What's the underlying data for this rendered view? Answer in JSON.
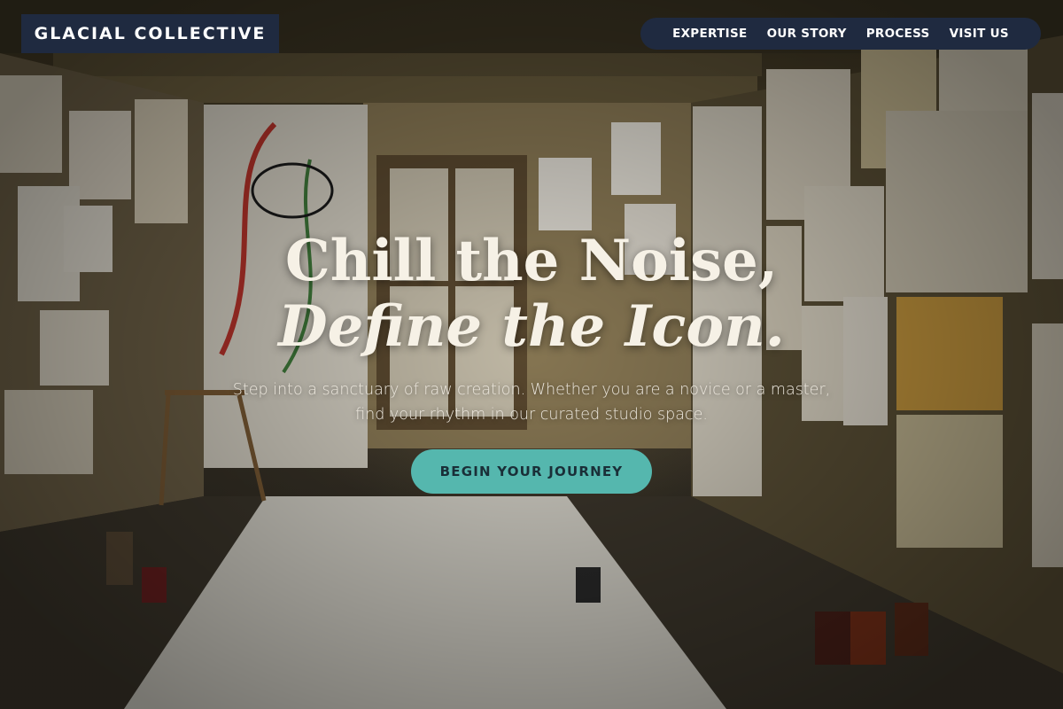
{
  "brand": {
    "name": "GLACIAL COLLECTIVE"
  },
  "nav": {
    "items": [
      {
        "label": "EXPERTISE"
      },
      {
        "label": "OUR STORY"
      },
      {
        "label": "PROCESS"
      },
      {
        "label": "VISIT US"
      }
    ]
  },
  "hero": {
    "title_line1": "Chill the Noise,",
    "title_line2": "Define the Icon.",
    "subtitle": "Step into a sanctuary of raw creation. Whether you are a novice or a master, find your rhythm in our curated studio space.",
    "cta_label": "BEGIN YOUR JOURNEY"
  },
  "colors": {
    "header_bg": "#1f2a40",
    "accent": "#55b7ae",
    "text_light": "#f6f1e6"
  }
}
